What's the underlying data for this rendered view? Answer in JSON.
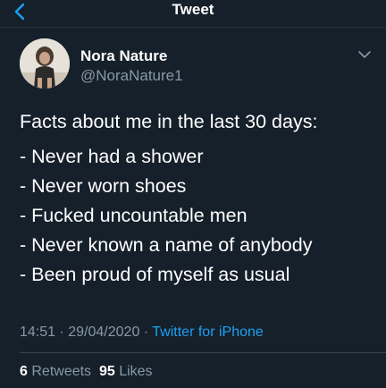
{
  "header": {
    "title": "Tweet",
    "back_icon": "chevron-left-icon"
  },
  "author": {
    "name": "Nora Nature",
    "handle": "@NoraNature1",
    "more_icon": "chevron-down-icon"
  },
  "tweet": {
    "intro": "Facts about me in the last 30 days:",
    "lines": [
      "- Never had a shower",
      "- Never worn shoes",
      "- Fucked uncountable men",
      "- Never known a name of anybody",
      "- Been proud of myself as usual"
    ]
  },
  "meta": {
    "time": "14:51",
    "sep1": " · ",
    "date": "29/04/2020",
    "sep2": " · ",
    "source": "Twitter for iPhone"
  },
  "stats": {
    "retweets_count": "6",
    "retweets_label": "Retweets",
    "likes_count": "95",
    "likes_label": "Likes"
  },
  "colors": {
    "background": "#15202b",
    "text": "#ffffff",
    "secondary": "#8899a6",
    "accent": "#1da1f2",
    "divider": "#38444d"
  }
}
